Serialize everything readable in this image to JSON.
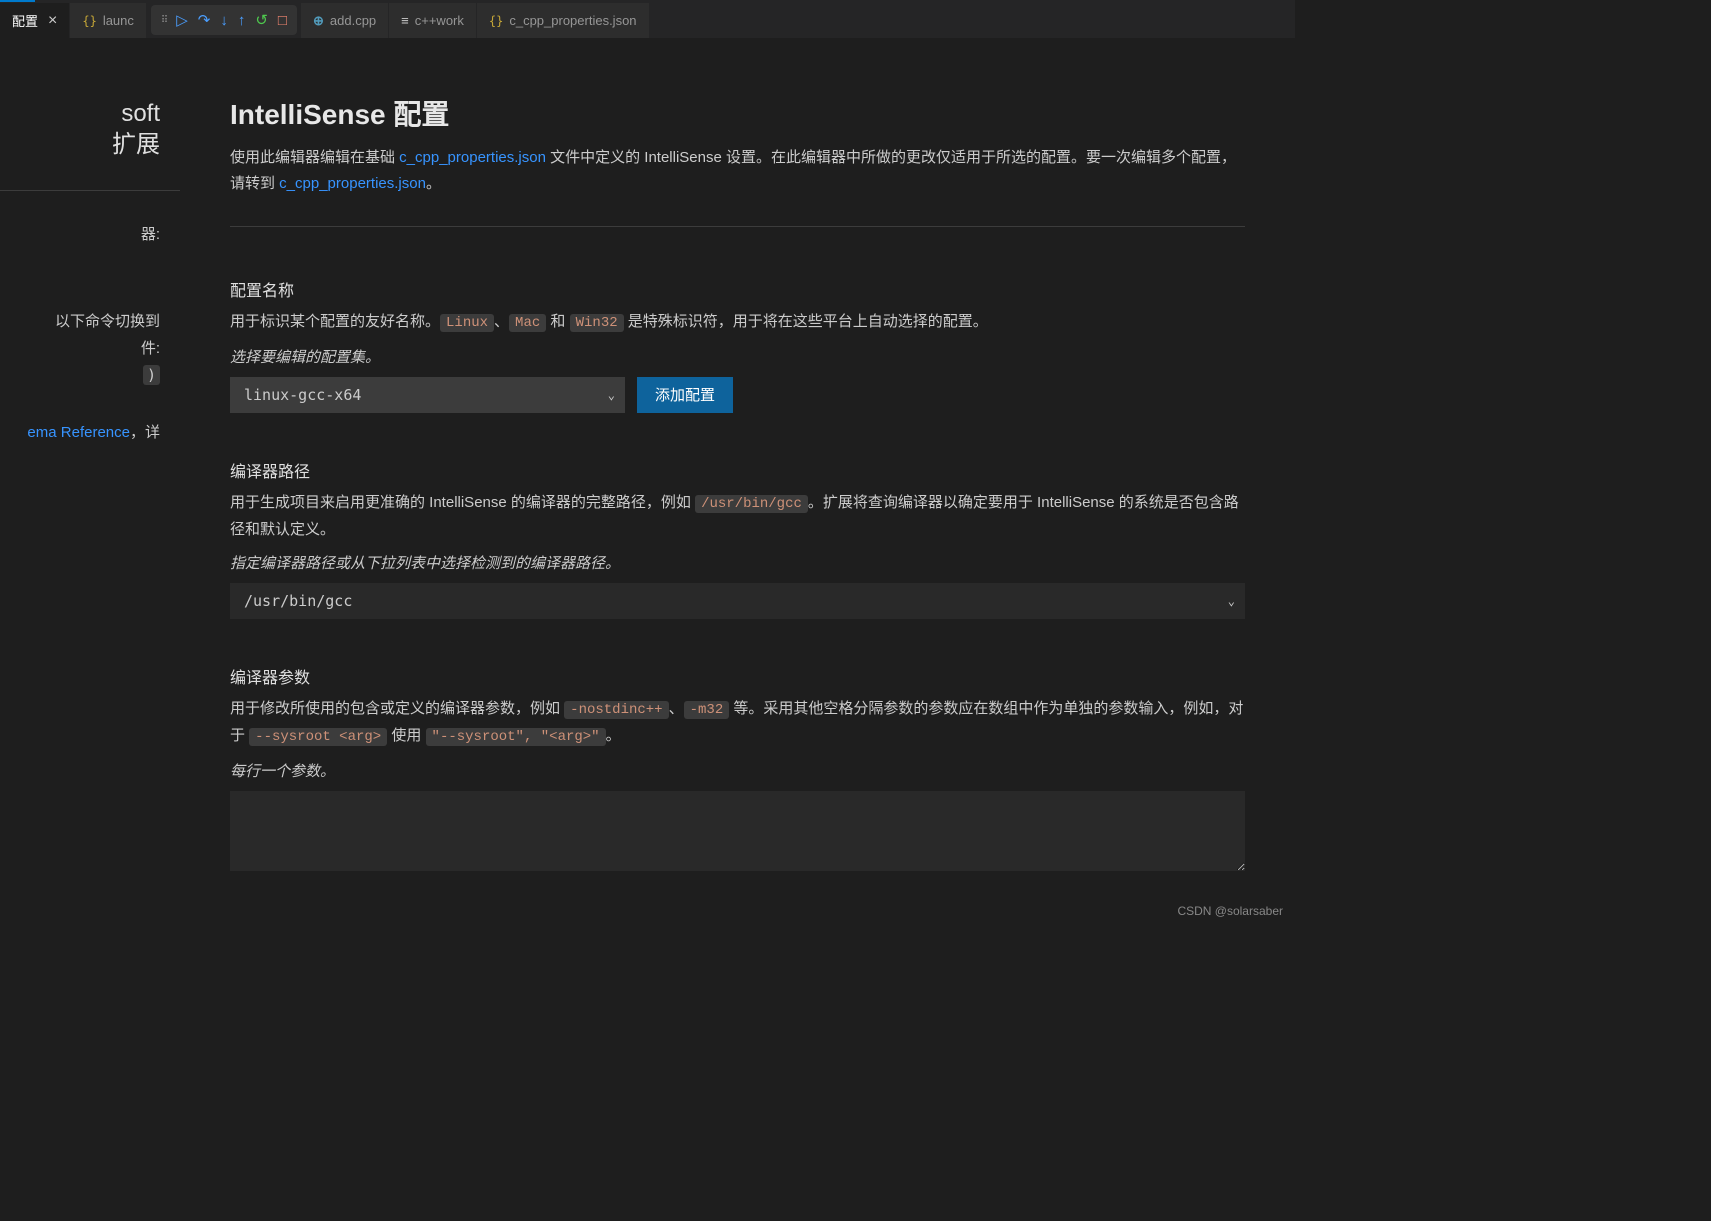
{
  "tabs": {
    "active": {
      "label": "配置"
    },
    "launch": {
      "label": "launc"
    },
    "add": {
      "label": "add.cpp"
    },
    "work": {
      "label": "c++work"
    },
    "props": {
      "label": "c_cpp_properties.json"
    }
  },
  "sidebar": {
    "heading1": "soft",
    "heading2": "扩展",
    "label_colon": "器:",
    "cmd_line1": "以下命令切换到",
    "cmd_line2": "件:",
    "cmd_paren": ")",
    "ref_link": "ema Reference",
    "ref_suffix": "，详"
  },
  "page": {
    "title": "IntelliSense 配置",
    "desc_prefix": "使用此编辑器编辑在基础 ",
    "desc_link1": "c_cpp_properties.json",
    "desc_mid": " 文件中定义的 IntelliSense 设置。在此编辑器中所做的更改仅适用于所选的配置。要一次编辑多个配置，请转到 ",
    "desc_link2": "c_cpp_properties.json",
    "desc_suffix": "。"
  },
  "config_name": {
    "label": "配置名称",
    "desc_prefix": "用于标识某个配置的友好名称。",
    "code1": "Linux",
    "sep1": "、",
    "code2": "Mac",
    "sep2": " 和 ",
    "code3": "Win32",
    "desc_suffix": " 是特殊标识符，用于将在这些平台上自动选择的配置。",
    "hint": "选择要编辑的配置集。",
    "value": "linux-gcc-x64",
    "add_button": "添加配置"
  },
  "compiler_path": {
    "label": "编译器路径",
    "desc_prefix": "用于生成项目来启用更准确的 IntelliSense 的编译器的完整路径，例如 ",
    "code1": "/usr/bin/gcc",
    "desc_suffix": "。扩展将查询编译器以确定要用于 IntelliSense 的系统是否包含路径和默认定义。",
    "hint": "指定编译器路径或从下拉列表中选择检测到的编译器路径。",
    "value": "/usr/bin/gcc"
  },
  "compiler_args": {
    "label": "编译器参数",
    "desc_prefix": "用于修改所使用的包含或定义的编译器参数，例如 ",
    "code1": "-nostdinc++",
    "sep1": "、",
    "code2": "-m32",
    "desc_mid": " 等。采用其他空格分隔参数的参数应在数组中作为单独的参数输入，例如，对于 ",
    "code3": "--sysroot <arg>",
    "desc_mid2": " 使用 ",
    "code4": "\"--sysroot\", \"<arg>\"",
    "desc_suffix": "。",
    "hint": "每行一个参数。",
    "value": ""
  },
  "watermark": "CSDN @solarsaber"
}
